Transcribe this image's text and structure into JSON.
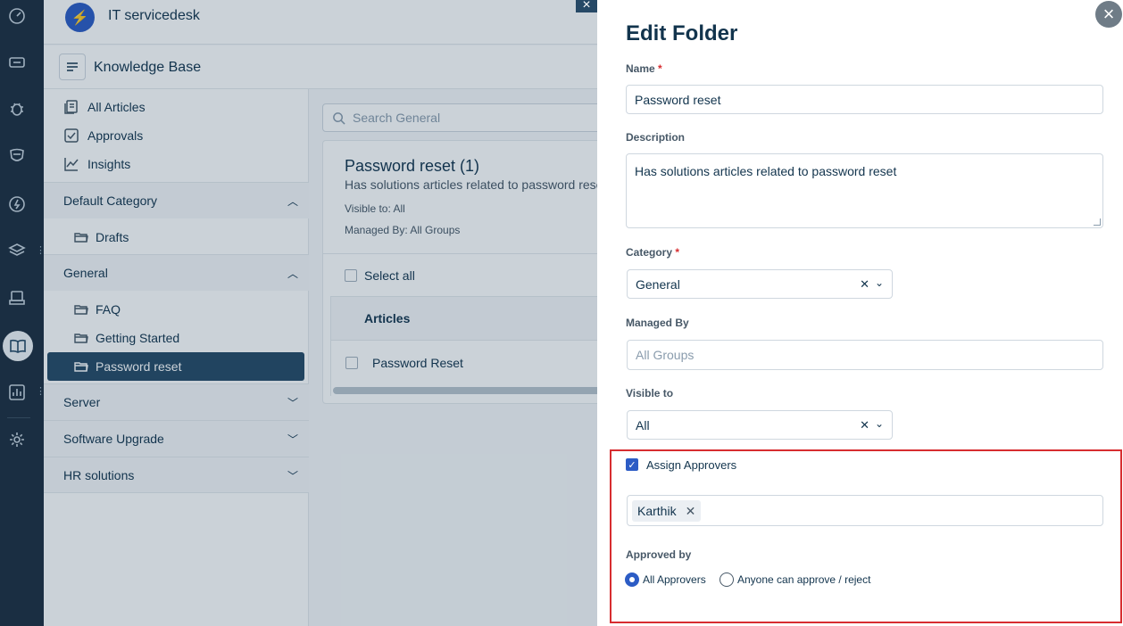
{
  "app": {
    "name": "IT servicedesk"
  },
  "kb": {
    "title": "Knowledge Base"
  },
  "nav": {
    "all_articles": "All Articles",
    "approvals": "Approvals",
    "insights": "Insights"
  },
  "tree": {
    "default_category": "Default Category",
    "drafts": "Drafts",
    "general": "General",
    "faq": "FAQ",
    "getting_started": "Getting Started",
    "password_reset": "Password reset",
    "server": "Server",
    "software_upgrade": "Software Upgrade",
    "hr_solutions": "HR solutions"
  },
  "search": {
    "placeholder": "Search General"
  },
  "folder": {
    "title": "Password reset (1)",
    "description": "Has solutions articles related to password reset",
    "visible_to": "Visible to: All",
    "managed_by": "Managed By: All Groups",
    "select_all": "Select all",
    "articles_header": "Articles",
    "articles": [
      "Password Reset"
    ]
  },
  "modal": {
    "title": "Edit Folder",
    "name_label": "Name",
    "name_value": "Password reset",
    "description_label": "Description",
    "description_value": "Has solutions articles related to password reset",
    "category_label": "Category",
    "category_value": "General",
    "managed_by_label": "Managed By",
    "managed_by_placeholder": "All Groups",
    "visible_to_label": "Visible to",
    "visible_to_value": "All",
    "assign_approvers_label": "Assign Approvers",
    "assign_approvers_checked": true,
    "approvers": [
      "Karthik"
    ],
    "approved_by_label": "Approved by",
    "approved_by_options": [
      "All Approvers",
      "Anyone can approve / reject"
    ],
    "approved_by_selected": "All Approvers"
  },
  "colors": {
    "rail": "#1d2e3f",
    "accent": "#2c5cc5",
    "active_folder": "#264966",
    "highlight_box": "#d72d30"
  }
}
